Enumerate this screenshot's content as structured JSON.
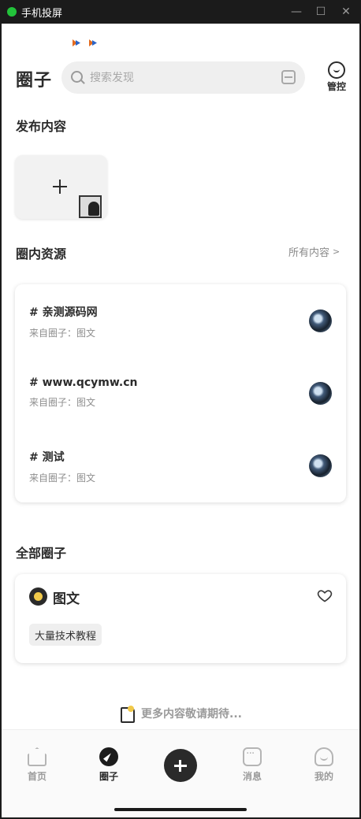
{
  "window": {
    "title": "手机投屏",
    "minimize": "—",
    "maximize": "☐",
    "close": "✕"
  },
  "header": {
    "brand": "圈子",
    "search_placeholder": "搜索发现",
    "manage_label": "管控"
  },
  "publish": {
    "title": "发布内容"
  },
  "resources": {
    "title": "圈内资源",
    "all_content": "所有内容",
    "chevron": ">",
    "items": [
      {
        "name": "# 亲测源码网",
        "source": "来自圈子：图文"
      },
      {
        "name": "# www.qcymw.cn",
        "source": "来自圈子：图文"
      },
      {
        "name": "# 测试",
        "source": "来自圈子：图文"
      }
    ]
  },
  "circles": {
    "title": "全部圈子",
    "items": [
      {
        "name": "图文",
        "tag": "大量技术教程"
      }
    ]
  },
  "footer_note": "更多内容敬请期待...",
  "tabbar": {
    "tabs": [
      {
        "label": "首页",
        "icon": "home-icon"
      },
      {
        "label": "圈子",
        "icon": "compass-icon",
        "active": true
      },
      {
        "label": "",
        "icon": "plus-icon"
      },
      {
        "label": "消息",
        "icon": "message-icon"
      },
      {
        "label": "我的",
        "icon": "profile-icon"
      }
    ]
  },
  "colors": {
    "app_dot": "#22c33a",
    "text_primary": "#2b2b2b",
    "text_muted": "#8e8e8e",
    "accent_yellow": "#f1c94a"
  }
}
